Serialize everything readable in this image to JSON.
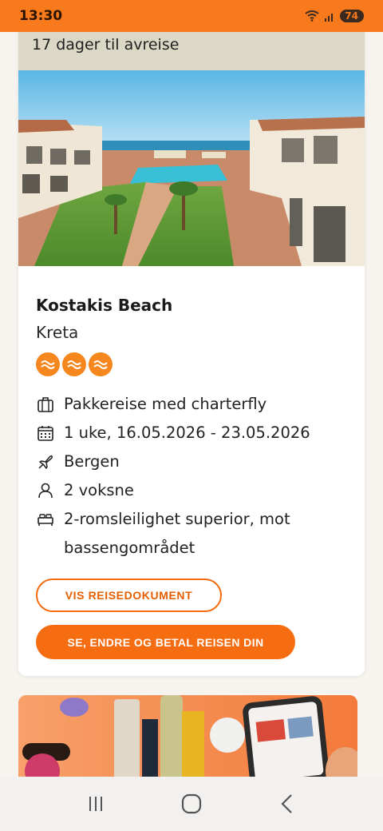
{
  "status_bar": {
    "time": "13:30",
    "battery": "74"
  },
  "booking": {
    "countdown": "17 dager til avreise",
    "hotel_name": "Kostakis Beach",
    "region": "Kreta",
    "rating": 3,
    "details": [
      {
        "icon": "suitcase-icon",
        "text": "Pakkereise med charterfly"
      },
      {
        "icon": "calendar-icon",
        "text": "1 uke, 16.05.2026 - 23.05.2026"
      },
      {
        "icon": "airplane-icon",
        "text": "Bergen"
      },
      {
        "icon": "person-icon",
        "text": "2 voksne"
      },
      {
        "icon": "bed-icon",
        "text": "2-romsleilighet superior, mot bassengområdet"
      }
    ],
    "travel_docs_button": "VIS REISEDOKUMENT",
    "manage_button": "SE, ENDRE OG BETAL REISEN DIN"
  },
  "colors": {
    "accent": "#f66c10",
    "status_bar": "#f97a1c",
    "countdown_bg": "#dcd8c6"
  }
}
